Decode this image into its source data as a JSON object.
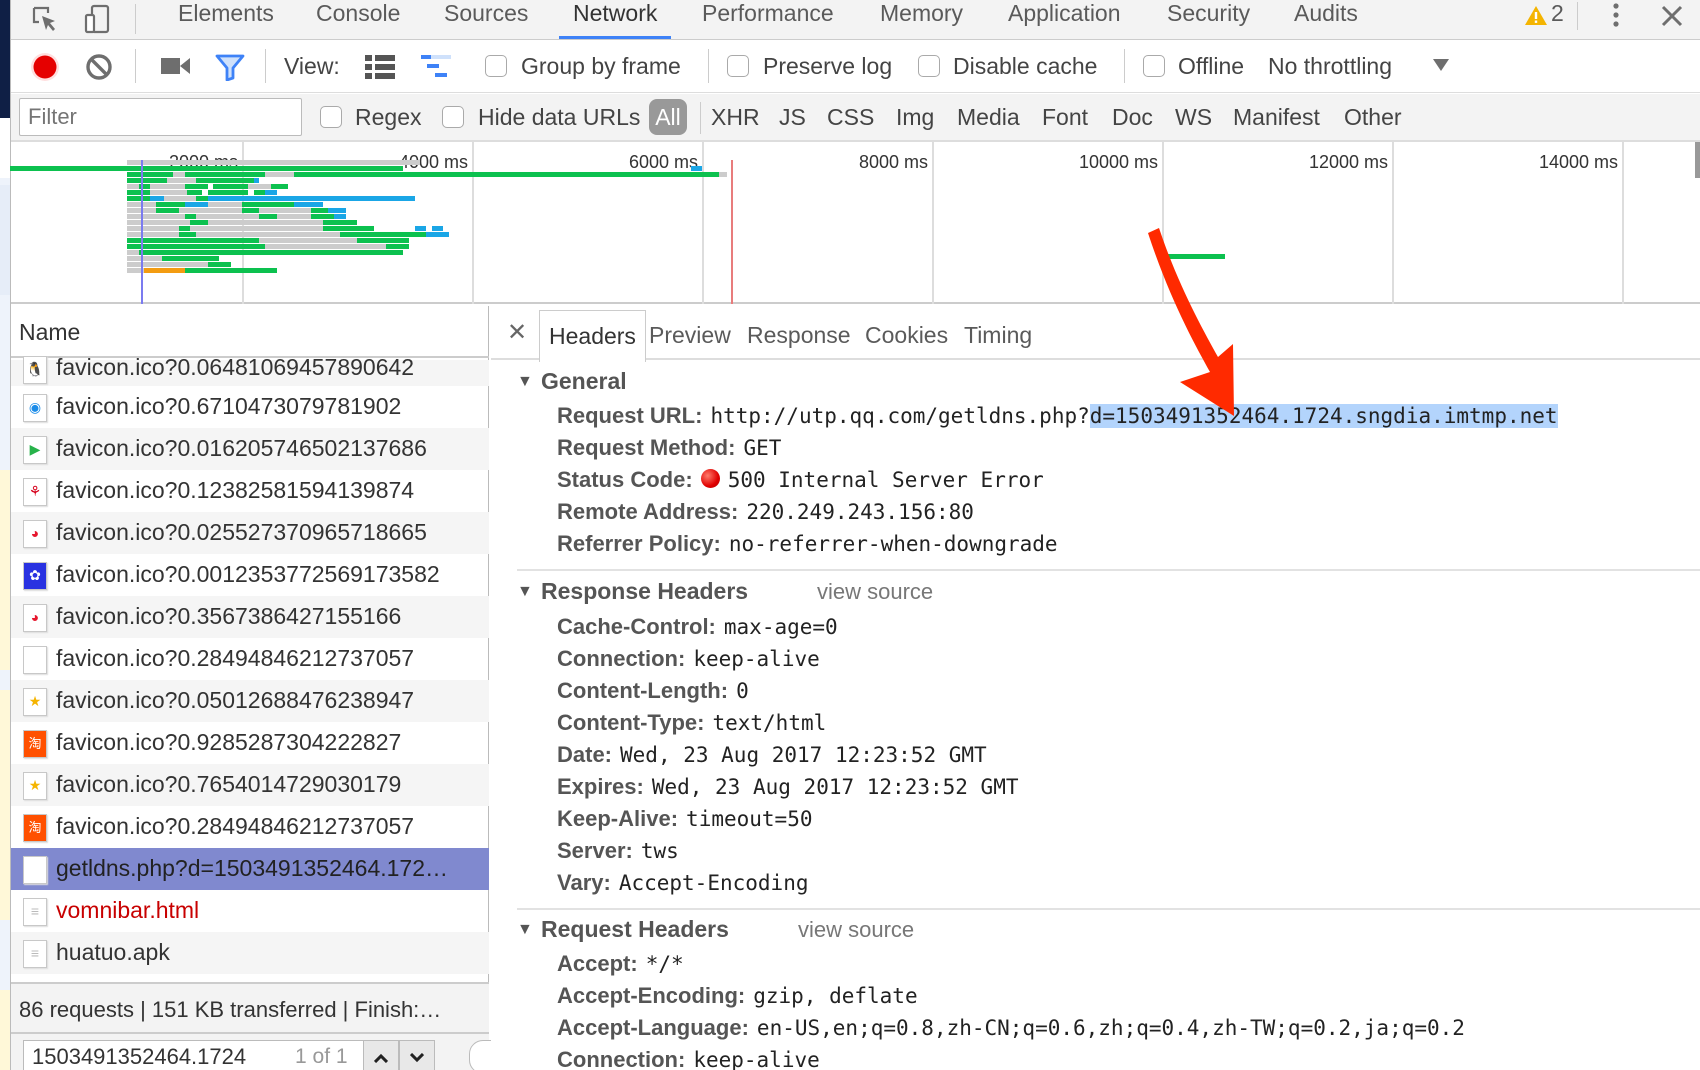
{
  "devtools_tabs": [
    {
      "label": "Elements"
    },
    {
      "label": "Console"
    },
    {
      "label": "Sources"
    },
    {
      "label": "Network",
      "active": true
    },
    {
      "label": "Performance"
    },
    {
      "label": "Memory"
    },
    {
      "label": "Application"
    },
    {
      "label": "Security"
    },
    {
      "label": "Audits"
    }
  ],
  "warning_count": "2",
  "toolbar": {
    "view_label": "View:",
    "group_by_frame": "Group by frame",
    "preserve_log": "Preserve log",
    "disable_cache": "Disable cache",
    "offline": "Offline",
    "throttling": "No throttling",
    "record_color": "#e50000",
    "filter_icon_color": "#3e82f7"
  },
  "filterbar": {
    "placeholder": "Filter",
    "regex": "Regex",
    "hide_data_urls": "Hide data URLs",
    "all": "All",
    "types": [
      "XHR",
      "JS",
      "CSS",
      "Img",
      "Media",
      "Font",
      "Doc",
      "WS",
      "Manifest",
      "Other"
    ]
  },
  "timeline": {
    "ticks": [
      "2000 ms",
      "4000 ms",
      "6000 ms",
      "8000 ms",
      "10000 ms",
      "12000 ms",
      "14000 ms"
    ],
    "dom_content_loaded_ms": 500,
    "load_ms": 6250,
    "colors": {
      "waiting": "#cccccc",
      "download": "#0cc14f",
      "ssl": "#1aa6e6",
      "queue": "#f39c12",
      "dcl": "#7b7bf0",
      "load": "#e87c7c"
    }
  },
  "request_list": {
    "header": "Name",
    "rows": [
      {
        "name": "favicon.ico?0.06481069457890642",
        "icon": "qq-penguin-icon",
        "glyph": "🐧"
      },
      {
        "name": "favicon.ico?0.6710473079781902",
        "icon": "qq-browser-icon",
        "glyph": "◉"
      },
      {
        "name": "favicon.ico?0.016205746502137686",
        "icon": "tencent-video-icon",
        "glyph": "▶"
      },
      {
        "name": "favicon.ico?0.12382581594139874",
        "icon": "sohu-icon",
        "glyph": "⚘"
      },
      {
        "name": "favicon.ico?0.025527370965718665",
        "icon": "weibo-icon",
        "glyph": "◕"
      },
      {
        "name": "favicon.ico?0.0012353772569173582",
        "icon": "baidu-paw-icon",
        "glyph": "✿"
      },
      {
        "name": "favicon.ico?0.3567386427155166",
        "icon": "weibo-icon",
        "glyph": "◕"
      },
      {
        "name": "favicon.ico?0.28494846212737057",
        "icon": "blank-file-icon",
        "glyph": ""
      },
      {
        "name": "favicon.ico?0.05012688476238947",
        "icon": "star-icon",
        "glyph": "★"
      },
      {
        "name": "favicon.ico?0.9285287304222827",
        "icon": "taobao-icon",
        "glyph": "淘"
      },
      {
        "name": "favicon.ico?0.7654014729030179",
        "icon": "star-icon",
        "glyph": "★"
      },
      {
        "name": "favicon.ico?0.28494846212737057",
        "icon": "taobao-icon",
        "glyph": "淘"
      },
      {
        "name": "getldns.php?d=1503491352464.172…",
        "icon": "blank-file-icon",
        "glyph": "",
        "selected": true
      },
      {
        "name": "vomnibar.html",
        "icon": "document-icon",
        "glyph": "≡",
        "error": true
      },
      {
        "name": "huatuo.apk",
        "icon": "document-icon",
        "glyph": "≡"
      }
    ],
    "summary": "86 requests | 151 KB transferred | Finish:…",
    "search_value": "1503491352464.1724",
    "search_count": "1 of 1"
  },
  "detail": {
    "tabs": [
      {
        "label": "Headers",
        "active": true
      },
      {
        "label": "Preview"
      },
      {
        "label": "Response"
      },
      {
        "label": "Cookies"
      },
      {
        "label": "Timing"
      }
    ],
    "general": {
      "title": "General",
      "request_url_key": "Request URL:",
      "request_url_prefix": "http://utp.qq.com/getldns.php?",
      "request_url_highlight": "d=1503491352464.1724.sngdia.imtmp.net",
      "rows": [
        {
          "key": "Request Method:",
          "value": "GET"
        },
        {
          "key": "Status Code:",
          "value": "500 Internal Server Error",
          "status_color": "#e00000"
        },
        {
          "key": "Remote Address:",
          "value": "220.249.243.156:80"
        },
        {
          "key": "Referrer Policy:",
          "value": "no-referrer-when-downgrade"
        }
      ]
    },
    "response_headers": {
      "title": "Response Headers",
      "view_source": "view source",
      "rows": [
        {
          "key": "Cache-Control:",
          "value": "max-age=0"
        },
        {
          "key": "Connection:",
          "value": "keep-alive"
        },
        {
          "key": "Content-Length:",
          "value": "0"
        },
        {
          "key": "Content-Type:",
          "value": "text/html"
        },
        {
          "key": "Date:",
          "value": "Wed, 23 Aug 2017 12:23:52 GMT"
        },
        {
          "key": "Expires:",
          "value": "Wed, 23 Aug 2017 12:23:52 GMT"
        },
        {
          "key": "Keep-Alive:",
          "value": "timeout=50"
        },
        {
          "key": "Server:",
          "value": "tws"
        },
        {
          "key": "Vary:",
          "value": "Accept-Encoding"
        }
      ]
    },
    "request_headers": {
      "title": "Request Headers",
      "view_source": "view source",
      "rows": [
        {
          "key": "Accept:",
          "value": "*/*"
        },
        {
          "key": "Accept-Encoding:",
          "value": "gzip, deflate"
        },
        {
          "key": "Accept-Language:",
          "value": "en-US,en;q=0.8,zh-CN;q=0.6,zh;q=0.4,zh-TW;q=0.2,ja;q=0.2"
        },
        {
          "key": "Connection:",
          "value": "keep-alive"
        }
      ]
    }
  },
  "annotation": {
    "type": "arrow",
    "color": "#ff2a00",
    "points_to": "request_url_highlight"
  }
}
